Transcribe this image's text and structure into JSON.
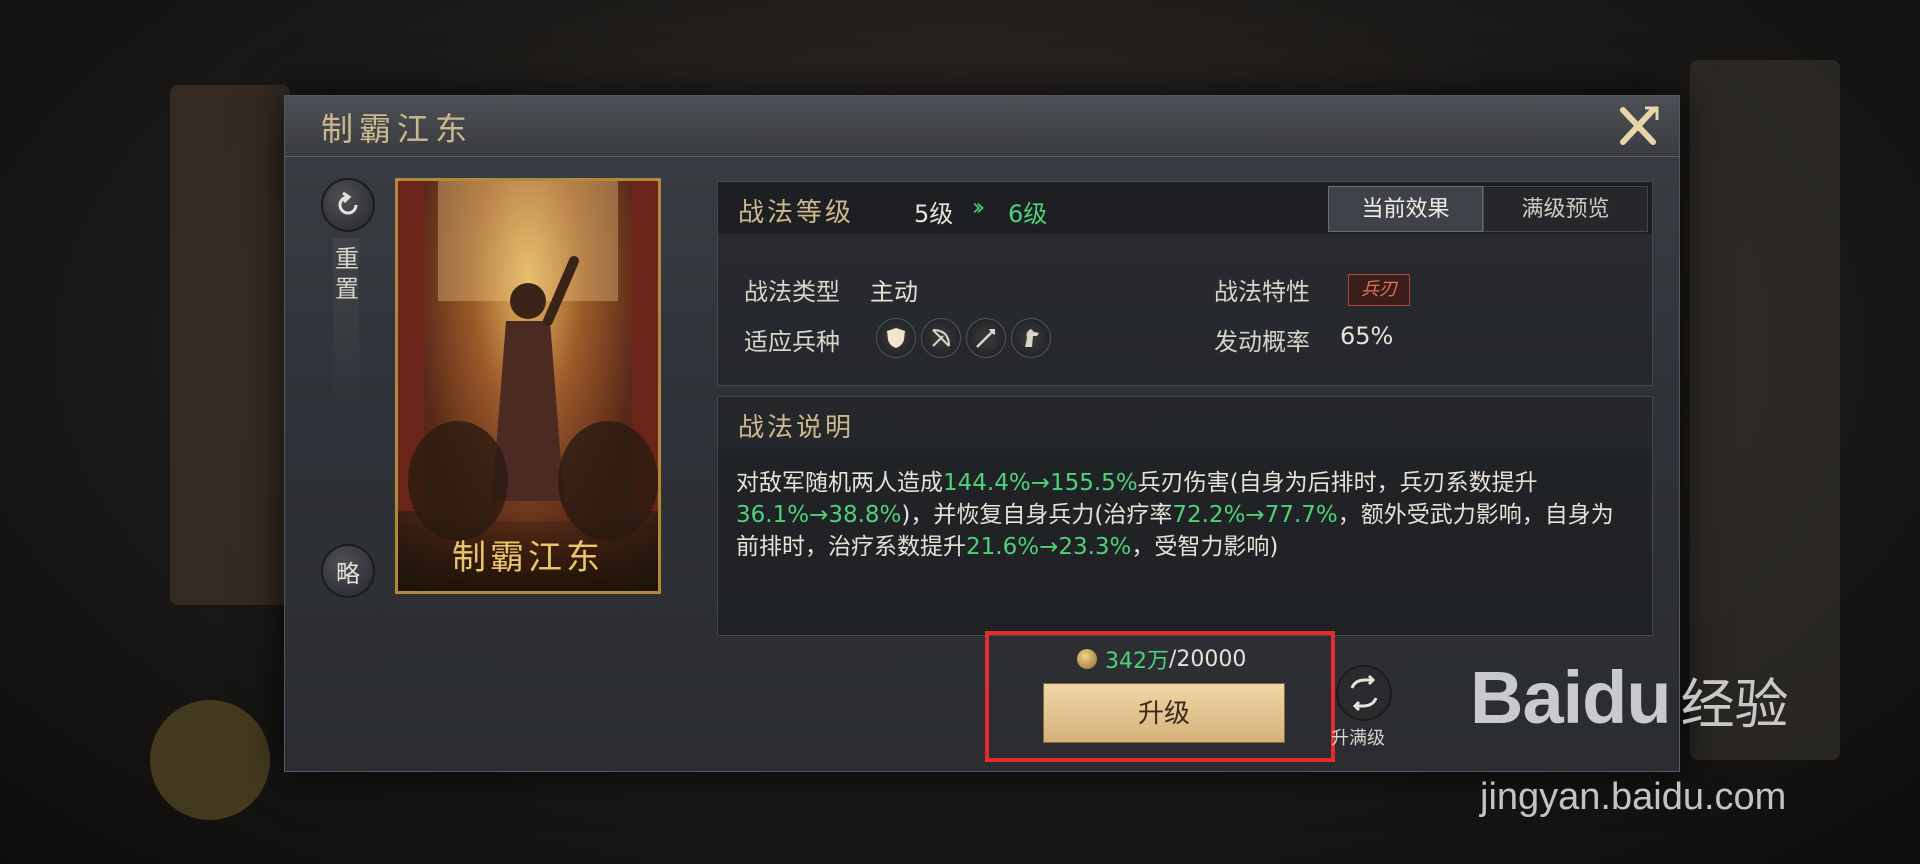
{
  "dialog": {
    "title": "制霸江东",
    "reset_label": "重置",
    "brief_label": "略",
    "card_name": "制霸江东",
    "level": {
      "label": "战法等级",
      "current": "5级",
      "arrow": "»",
      "next": "6级"
    },
    "tabs": [
      {
        "label": "当前效果",
        "active": true
      },
      {
        "label": "满级预览",
        "active": false
      }
    ],
    "rows": {
      "type_label": "战法类型",
      "type_value": "主动",
      "trait_label": "战法特性",
      "trait_value": "兵刃",
      "troops_label": "适应兵种",
      "troops": [
        "shield-icon",
        "bow-icon",
        "spear-icon",
        "horse-icon"
      ],
      "rate_label": "发动概率",
      "rate_value": "65%"
    },
    "description": {
      "title": "战法说明",
      "parts": [
        {
          "text": "对敌军随机两人造成",
          "hl": false
        },
        {
          "text": "144.4%→155.5%",
          "hl": true
        },
        {
          "text": "兵刃伤害(自身为后排时，兵刃系数提升",
          "hl": false
        },
        {
          "text": "36.1%→38.8%",
          "hl": true
        },
        {
          "text": ")，并恢复自身兵力(治疗率",
          "hl": false
        },
        {
          "text": "72.2%→77.7%",
          "hl": true
        },
        {
          "text": "，额外受武力影响，自身为前排时，治疗系数提升",
          "hl": false
        },
        {
          "text": "21.6%→23.3%",
          "hl": true
        },
        {
          "text": "，受智力影响)",
          "hl": false
        }
      ]
    },
    "cost": {
      "owned": "342万",
      "separator": "/",
      "required": "20000"
    },
    "upgrade_label": "升级",
    "max_label": "升满级"
  },
  "watermark": {
    "logo": "Baidu",
    "cn": "经验",
    "url": "jingyan.baidu.com"
  },
  "colors": {
    "accent_gold": "#cbb98d",
    "green": "#4fd17a",
    "highlight_red": "#e22d2d"
  }
}
